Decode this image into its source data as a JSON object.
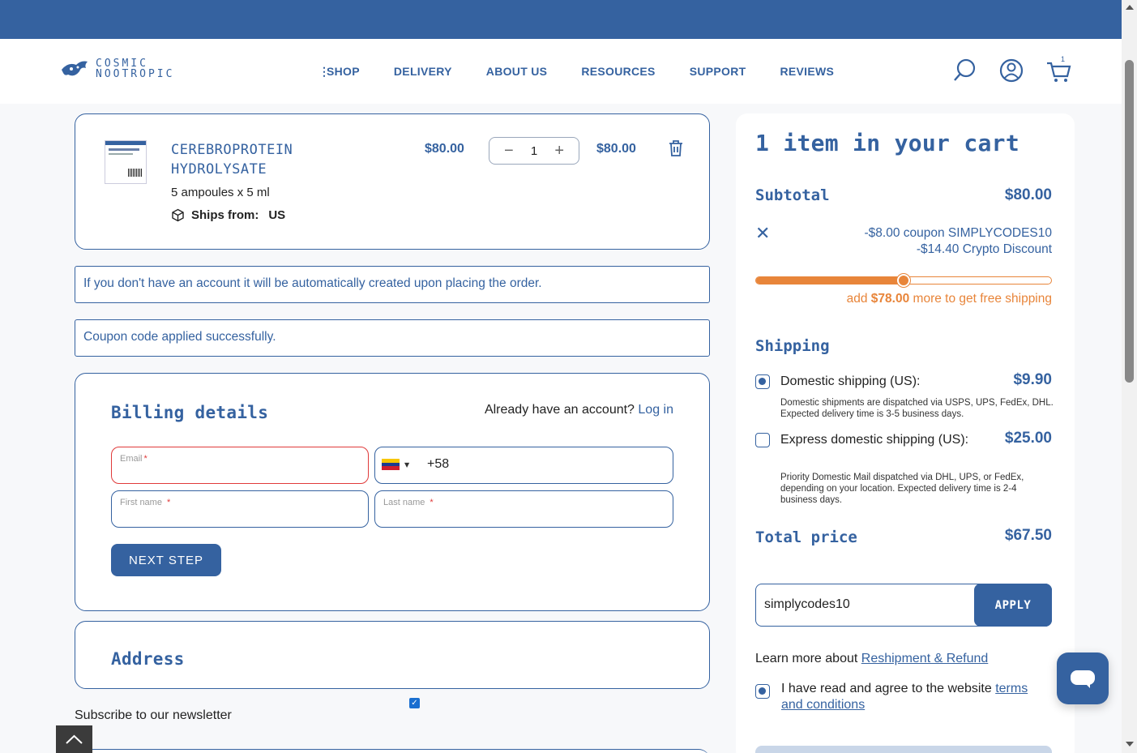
{
  "brand": {
    "line1": "COSMIC",
    "line2": "NOOTROPIC"
  },
  "nav": {
    "items": [
      {
        "label": "SHOP"
      },
      {
        "label": "DELIVERY"
      },
      {
        "label": "ABOUT US"
      },
      {
        "label": "RESOURCES"
      },
      {
        "label": "SUPPORT"
      },
      {
        "label": "REVIEWS"
      }
    ],
    "cart_count": "1"
  },
  "product": {
    "name": "CEREBROPROTEIN HYDROLYSATE",
    "variant": "5 ampoules x 5 ml",
    "ships_label": "Ships from:",
    "ships_value": "US",
    "unit_price": "$80.00",
    "quantity": "1",
    "line_total": "$80.00"
  },
  "notices": {
    "account": "If you don't have an account it will be automatically created upon placing the order.",
    "coupon": "Coupon code applied successfully."
  },
  "billing": {
    "title": "Billing details",
    "already_text": "Already have an account?",
    "login_link": "Log in",
    "email_label": "Email",
    "phone_code": "+58",
    "first_name_label": "First name",
    "last_name_label": "Last name",
    "required_mark": "*",
    "next_step": "NEXT STEP"
  },
  "address": {
    "title": "Address"
  },
  "newsletter": {
    "label": "Subscribe to our newsletter",
    "checked": true
  },
  "summary": {
    "title": "1 item in your cart",
    "subtotal_label": "Subtotal",
    "subtotal_value": "$80.00",
    "coupon_line": "-$8.00 coupon SIMPLYCODES10",
    "crypto_line": "-$14.40 Crypto Discount",
    "progress": 0.5,
    "free_ship_prefix": "add",
    "free_ship_amount": "$78.00",
    "free_ship_suffix": "more to get free shipping",
    "shipping_label": "Shipping",
    "options": [
      {
        "name": "Domestic shipping (US):",
        "price": "$9.90",
        "desc": "Domestic shipments are dispatched via USPS, UPS, FedEx, DHL. Expected delivery time is 3-5 business days.",
        "selected": true
      },
      {
        "name": "Express domestic shipping (US):",
        "price": "$25.00",
        "desc": "Priority Domestic Mail dispatched via DHL, UPS, or FedEx, depending on your location. Expected delivery time is 2-4 business days.",
        "selected": false
      }
    ],
    "total_label": "Total price",
    "total_value": "$67.50",
    "coupon_value": "simplycodes10",
    "apply_label": "APPLY",
    "learn_prefix": "Learn more about",
    "learn_link": "Reshipment & Refund",
    "terms_prefix": "I have read and agree to the website",
    "terms_link": "terms and conditions"
  },
  "colors": {
    "brand": "#3562a0",
    "accent": "#e8853a",
    "error": "#e03a3a"
  },
  "icons": [
    "search-icon",
    "user-icon",
    "cart-icon",
    "trash-icon",
    "box-icon",
    "close-icon",
    "chat-icon",
    "chevron-up-icon"
  ]
}
